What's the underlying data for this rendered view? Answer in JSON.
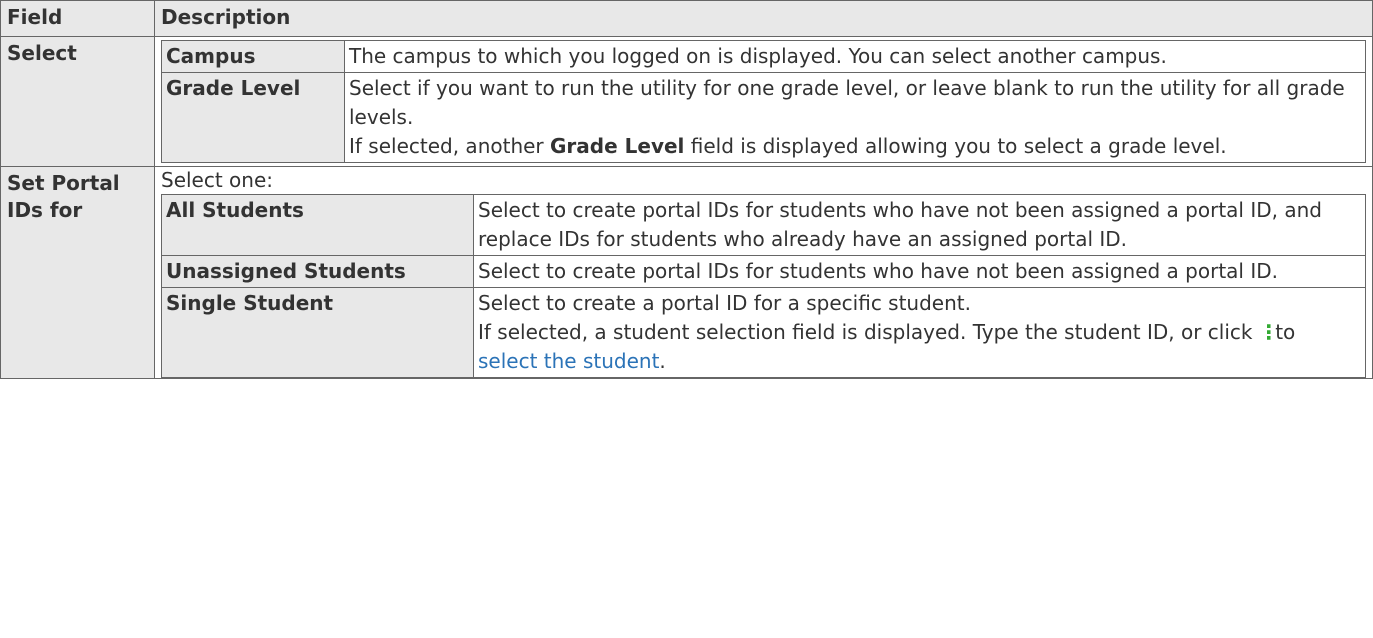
{
  "header": {
    "field": "Field",
    "description": "Description"
  },
  "select_section": {
    "field": "Select",
    "rows": [
      {
        "label": "Campus",
        "text": "The campus to which you logged on is displayed. You can select another campus."
      },
      {
        "label": "Grade Level",
        "text1": "Select if you want to run the utility for one grade level, or leave blank to run the utility for all grade levels.",
        "text2_pre": "If selected, another ",
        "text2_bold": "Grade Level",
        "text2_post": " field is displayed allowing you to select a grade level."
      }
    ]
  },
  "portal_section": {
    "field": "Set Portal IDs for",
    "intro": "Select one:",
    "rows": [
      {
        "label": "All Students",
        "text": "Select to create portal IDs for students who have not been assigned a portal ID, and replace IDs for students who already have an assigned portal ID."
      },
      {
        "label": "Unassigned Students",
        "text": "Select to create portal IDs for students who have not been assigned a portal ID."
      },
      {
        "label": "Single Student",
        "text1": "Select to create a portal ID for a specific student.",
        "text2_pre": "If selected, a student selection field is displayed. Type the student ID, or click ",
        "text2_mid": " to ",
        "link": "select the student",
        "text2_post": "."
      }
    ]
  },
  "icons": {
    "search": "vertical-ellipsis-icon"
  },
  "colors": {
    "header_bg": "#e8e8e8",
    "link": "#2b73b7",
    "icon": "#33aa33"
  }
}
